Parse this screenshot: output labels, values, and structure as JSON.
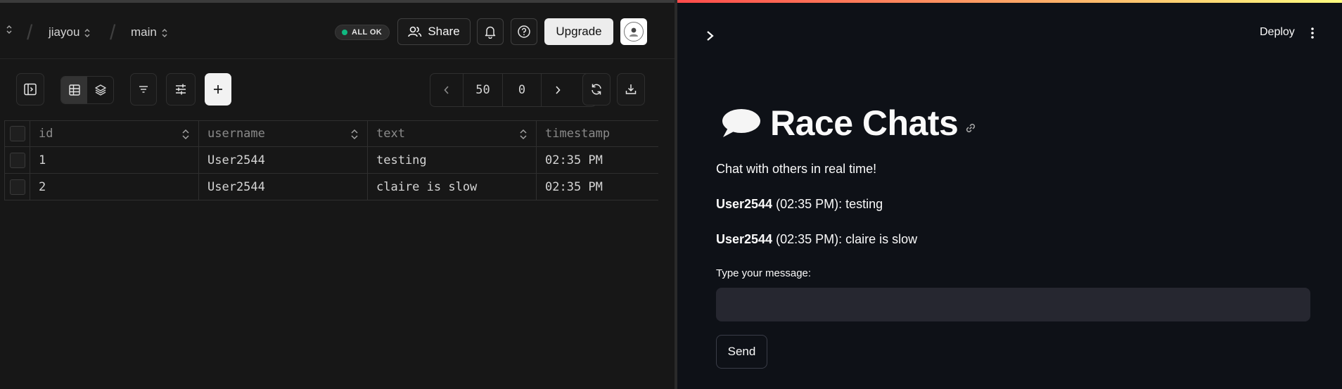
{
  "db": {
    "breadcrumb": {
      "project": "jiayou",
      "branch": "main"
    },
    "status_badge": "ALL OK",
    "share_label": "Share",
    "upgrade_label": "Upgrade",
    "pager": {
      "limit": "50",
      "offset": "0"
    },
    "table": {
      "columns": [
        "id",
        "username",
        "text",
        "timestamp"
      ],
      "rows": [
        {
          "id": "1",
          "username": "User2544",
          "text": "testing",
          "timestamp": "02:35 PM"
        },
        {
          "id": "2",
          "username": "User2544",
          "text": "claire is slow",
          "timestamp": "02:35 PM"
        }
      ]
    }
  },
  "app": {
    "deploy_label": "Deploy",
    "title_emoji": "speech-balloon-icon",
    "title": "Race Chats",
    "subtitle": "Chat with others in real time!",
    "messages": [
      {
        "user": "User2544",
        "meta": " (02:35 PM): testing"
      },
      {
        "user": "User2544",
        "meta": " (02:35 PM): claire is slow"
      }
    ],
    "input_label": "Type your message:",
    "input_value": "",
    "send_label": "Send"
  },
  "colors": {
    "accent_green": "#10b981",
    "app_bg": "#0e1117",
    "db_bg": "#171717"
  }
}
